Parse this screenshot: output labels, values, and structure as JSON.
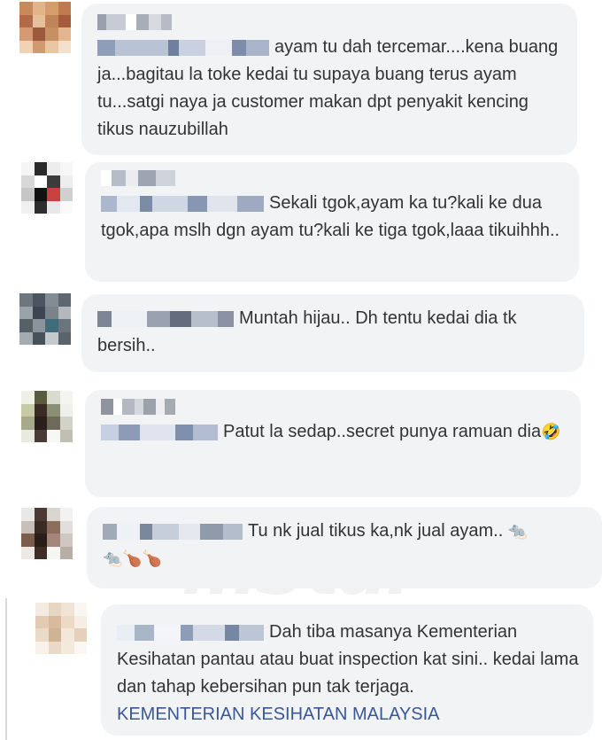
{
  "comments": [
    {
      "text": "ayam tu dah tercemar....kena buang ja...bagitau la toke kedai tu supaya buang terus ayam tu...satgi naya ja customer makan dpt penyakit kencing tikus nauzubillah"
    },
    {
      "text": "Sekali tgok,ayam ka tu?kali ke dua tgok,apa mslh dgn ayam tu?kali ke tiga tgok,laaa tikuihhh.."
    },
    {
      "text": "Muntah hijau.. Dh tentu kedai dia tk bersih.."
    },
    {
      "text": "Patut la sedap..secret punya ramuan dia",
      "emoji": "🤣"
    },
    {
      "text": "Tu nk jual tikus ka,nk jual ayam..",
      "emoji_trail": "🐀",
      "emoji_line2": "🐀🍗🍗"
    },
    {
      "text": "Dah tiba masanya Kementerian Kesihatan pantau atau buat inspection kat sini.. kedai lama dan tahap kebersihan pun tak terjaga.",
      "mention": "KEMENTERIAN KESIHATAN MALAYSIA"
    }
  ],
  "watermark": "mStar",
  "colors": {
    "bubble": "#f2f3f5",
    "mention": "#385898",
    "text": "#333333"
  }
}
